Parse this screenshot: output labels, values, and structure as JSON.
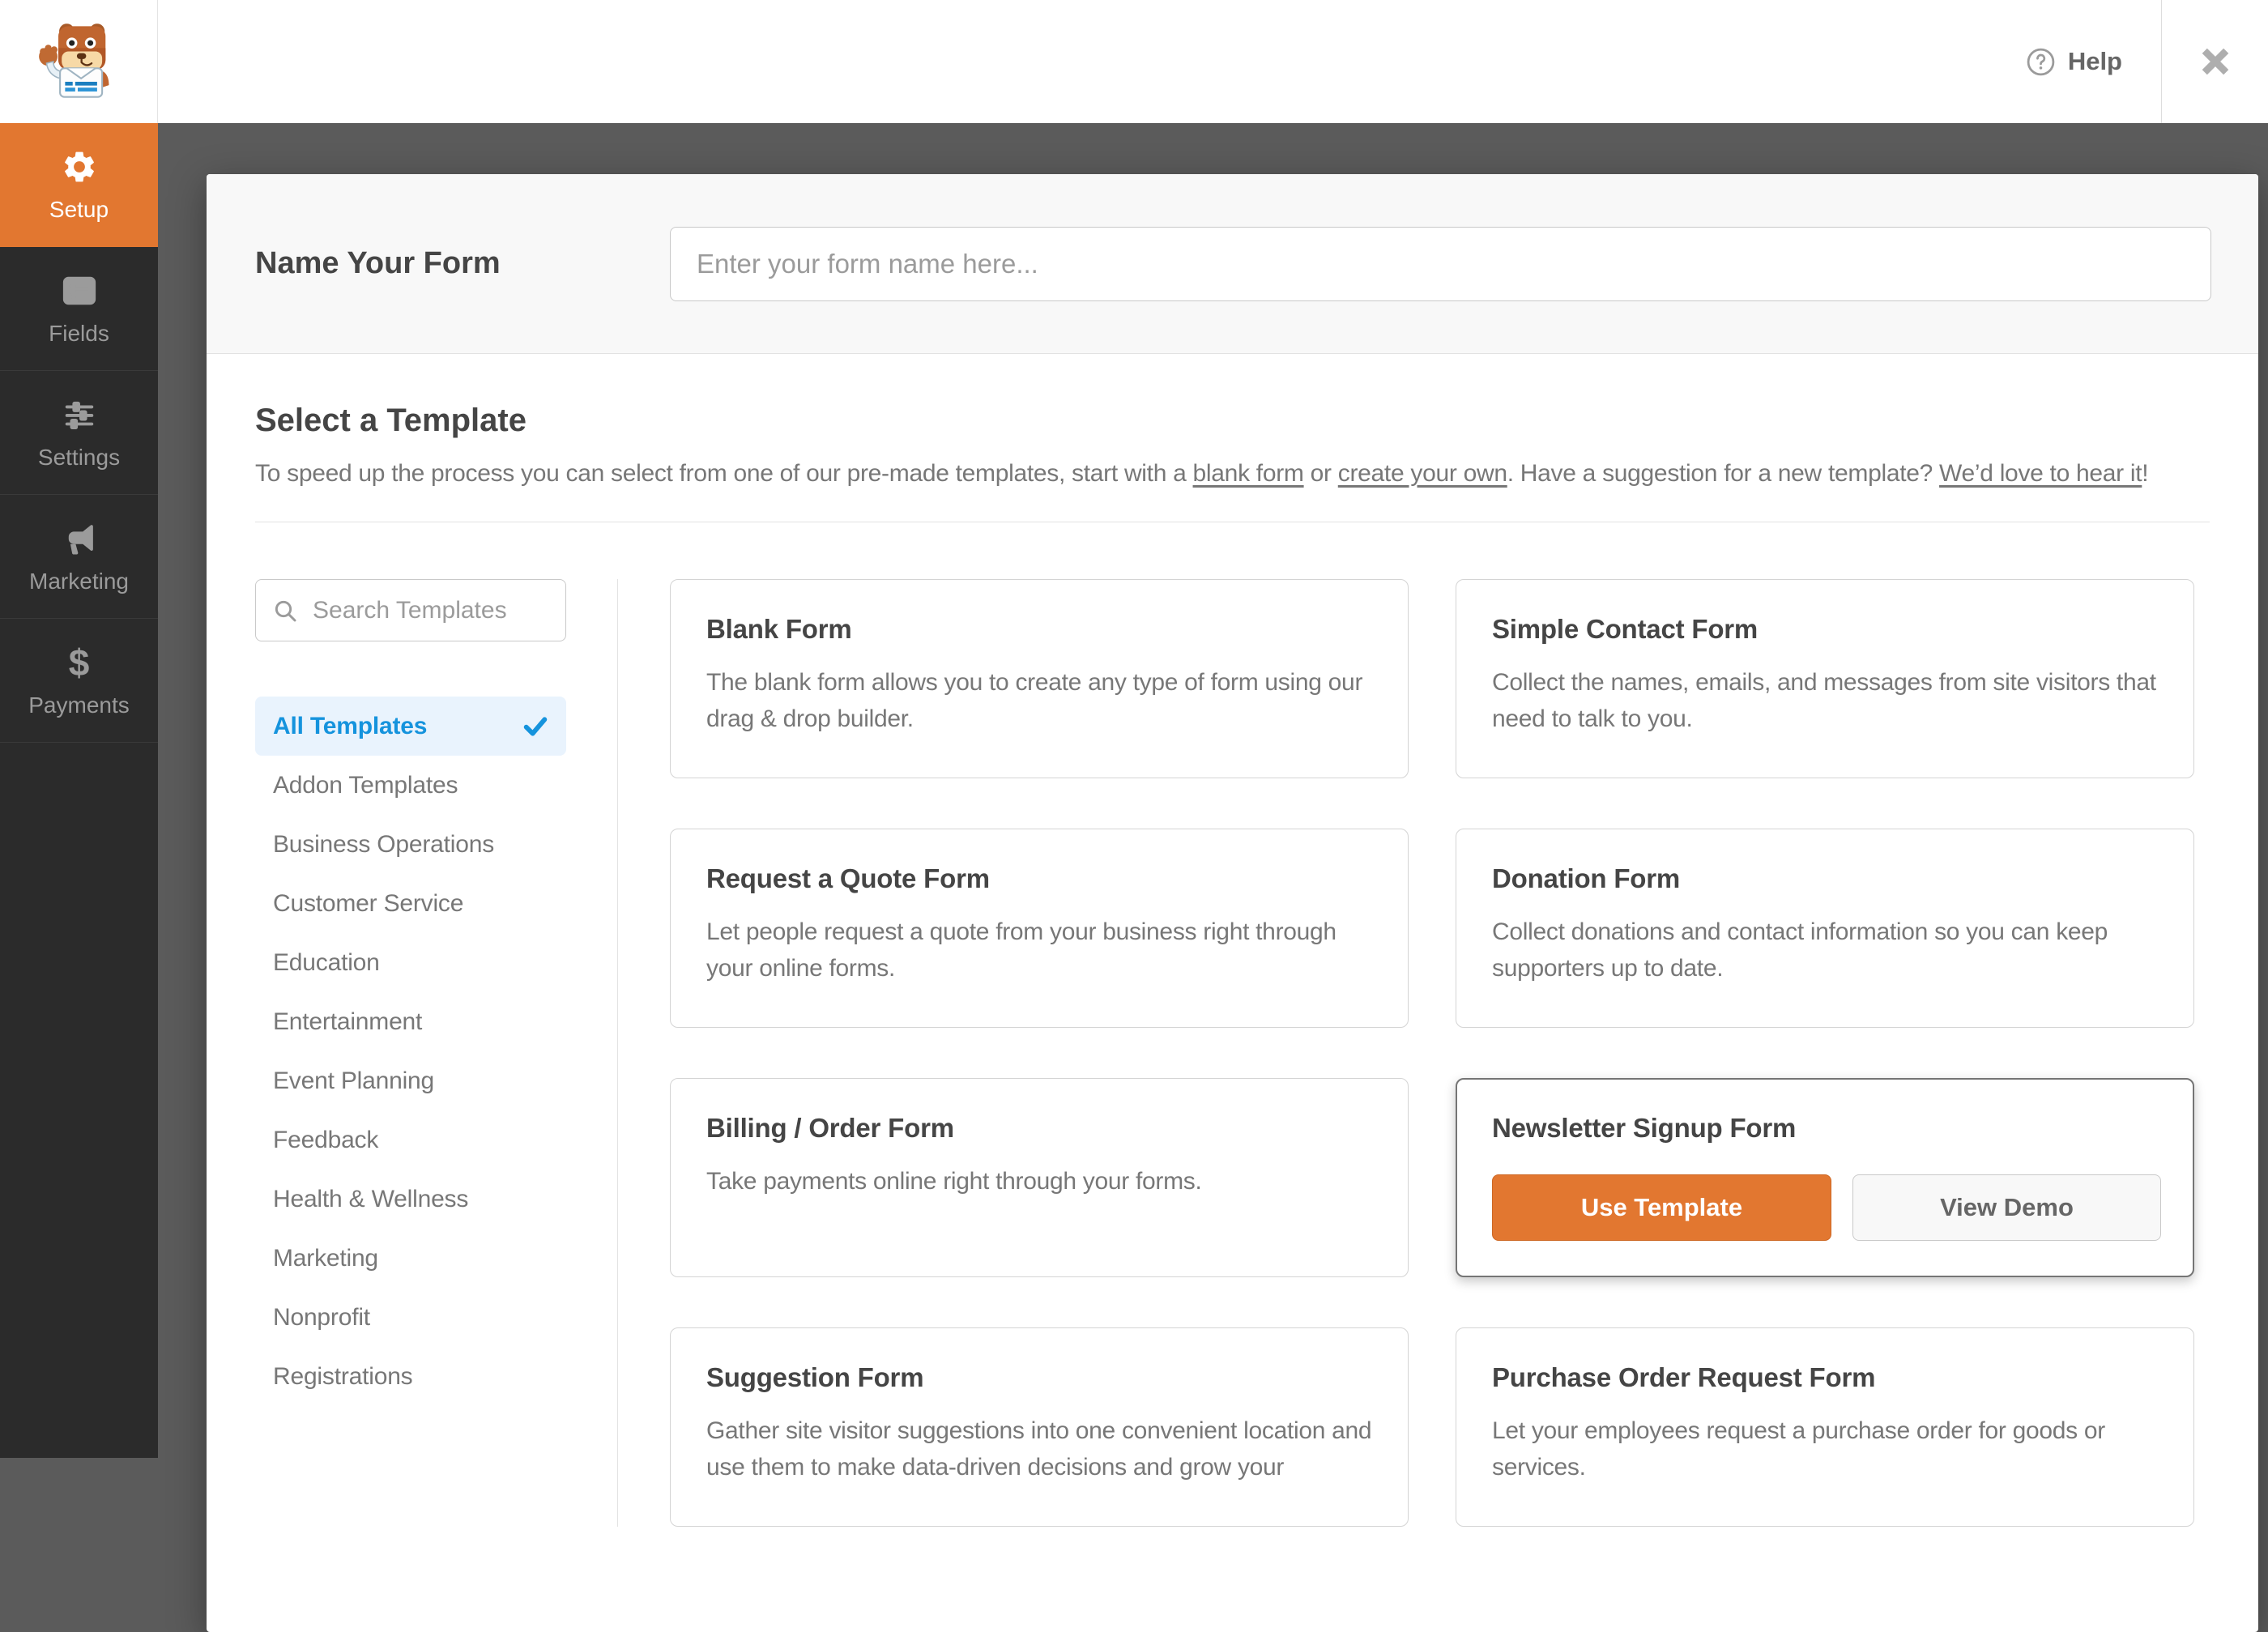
{
  "topbar": {
    "help_label": "Help"
  },
  "sidebar": {
    "items": [
      {
        "label": "Setup",
        "icon": "gear-icon",
        "active": true
      },
      {
        "label": "Fields",
        "icon": "form-fields-icon",
        "active": false
      },
      {
        "label": "Settings",
        "icon": "sliders-icon",
        "active": false
      },
      {
        "label": "Marketing",
        "icon": "megaphone-icon",
        "active": false
      },
      {
        "label": "Payments",
        "icon": "dollar-icon",
        "active": false
      }
    ]
  },
  "name_section": {
    "label": "Name Your Form",
    "input_value": "",
    "input_placeholder": "Enter your form name here..."
  },
  "select_section": {
    "title": "Select a Template",
    "description_segments": [
      {
        "text": "To speed up the process you can select from one of our pre-made templates, start with a ",
        "link": false
      },
      {
        "text": "blank form",
        "link": true
      },
      {
        "text": " or ",
        "link": false
      },
      {
        "text": "create your own",
        "link": true
      },
      {
        "text": ". Have a suggestion for a new template? ",
        "link": false
      },
      {
        "text": "We’d love to hear it",
        "link": true
      },
      {
        "text": "!",
        "link": false
      }
    ]
  },
  "search": {
    "placeholder": "Search Templates",
    "value": ""
  },
  "categories": [
    {
      "label": "All Templates",
      "selected": true
    },
    {
      "label": "Addon Templates",
      "selected": false
    },
    {
      "label": "Business Operations",
      "selected": false
    },
    {
      "label": "Customer Service",
      "selected": false
    },
    {
      "label": "Education",
      "selected": false
    },
    {
      "label": "Entertainment",
      "selected": false
    },
    {
      "label": "Event Planning",
      "selected": false
    },
    {
      "label": "Feedback",
      "selected": false
    },
    {
      "label": "Health & Wellness",
      "selected": false
    },
    {
      "label": "Marketing",
      "selected": false
    },
    {
      "label": "Nonprofit",
      "selected": false
    },
    {
      "label": "Registrations",
      "selected": false
    }
  ],
  "templates": [
    {
      "title": "Blank Form",
      "description": "The blank form allows you to create any type of form using our drag & drop builder.",
      "state": "default"
    },
    {
      "title": "Simple Contact Form",
      "description": "Collect the names, emails, and messages from site visitors that need to talk to you.",
      "state": "default"
    },
    {
      "title": "Request a Quote Form",
      "description": "Let people request a quote from your business right through your online forms.",
      "state": "default"
    },
    {
      "title": "Donation Form",
      "description": "Collect donations and contact information so you can keep supporters up to date.",
      "state": "default"
    },
    {
      "title": "Billing / Order Form",
      "description": "Take payments online right through your forms.",
      "state": "default"
    },
    {
      "title": "Newsletter Signup Form",
      "description": "",
      "state": "hovered",
      "buttons": {
        "use_template": "Use Template",
        "view_demo": "View Demo"
      }
    },
    {
      "title": "Suggestion Form",
      "description": "Gather site visitor suggestions into one convenient location and use them to make data-driven decisions and grow your",
      "state": "default"
    },
    {
      "title": "Purchase Order Request Form",
      "description": "Let your employees request a purchase order for goods or services.",
      "state": "default"
    }
  ],
  "colors": {
    "accent_orange": "#e27730",
    "link_blue": "#1593dd",
    "selected_bg": "#e9f3fd",
    "sidebar_bg": "#2b2b2b",
    "backdrop": "#5b5b5b"
  }
}
